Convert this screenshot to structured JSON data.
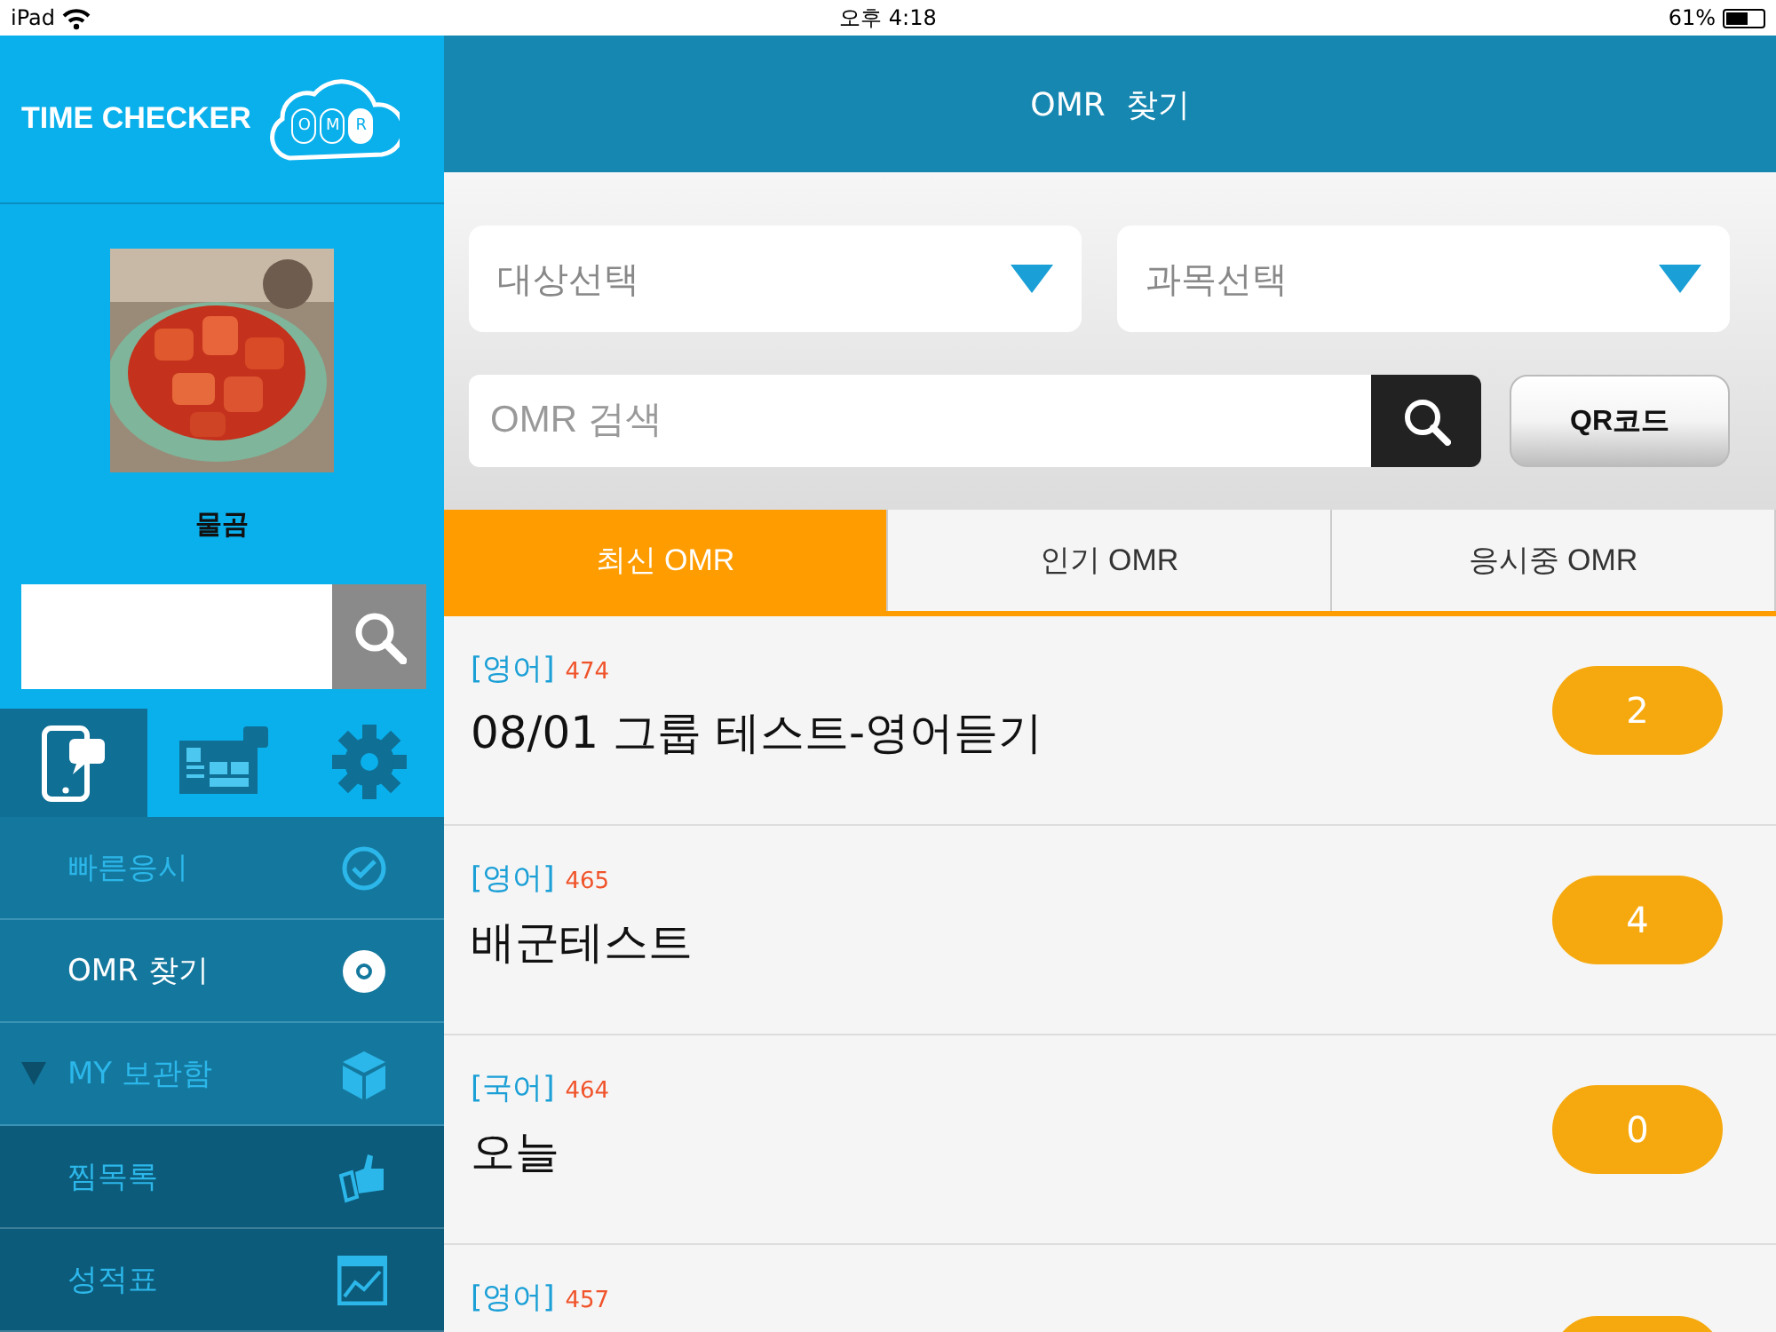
{
  "status_bar": {
    "device": "iPad",
    "time": "오후 4:18",
    "battery": "61%"
  },
  "sidebar": {
    "logo": "TIME CHECKER",
    "logo_badge": [
      "O",
      "M",
      "R"
    ],
    "profile": {
      "name": "물곰"
    },
    "tabs": [
      {
        "selected": true
      },
      {
        "selected": false
      },
      {
        "selected": false
      }
    ],
    "menu": [
      {
        "label": "빠른응시",
        "selected": false
      },
      {
        "label": "OMR 찾기",
        "selected": true
      },
      {
        "label": "MY 보관함",
        "selected": false,
        "expanded": true,
        "children": [
          {
            "label": "찜목록",
            "selected": false
          },
          {
            "label": "성적표",
            "selected": false
          }
        ]
      }
    ]
  },
  "header": {
    "title": "OMR  찾기"
  },
  "filters": {
    "dropdowns": [
      "대상선택",
      "과목선택"
    ],
    "search": {
      "placeholder": "OMR 검색"
    },
    "qr_button": "QR코드"
  },
  "tabs": [
    {
      "label": "최신 OMR",
      "selected": true
    },
    {
      "label": "인기 OMR",
      "selected": false
    },
    {
      "label": "응시중 OMR",
      "selected": false
    }
  ],
  "list": [
    {
      "subject": "[영어]",
      "number": "474",
      "title": "08/01 그룹 테스트-영어듣기",
      "count": "2"
    },
    {
      "subject": "[영어]",
      "number": "465",
      "title": "배군테스트",
      "count": "4"
    },
    {
      "subject": "[국어]",
      "number": "464",
      "title": "오늘",
      "count": "0"
    },
    {
      "subject": "[영어]",
      "number": "457"
    }
  ]
}
